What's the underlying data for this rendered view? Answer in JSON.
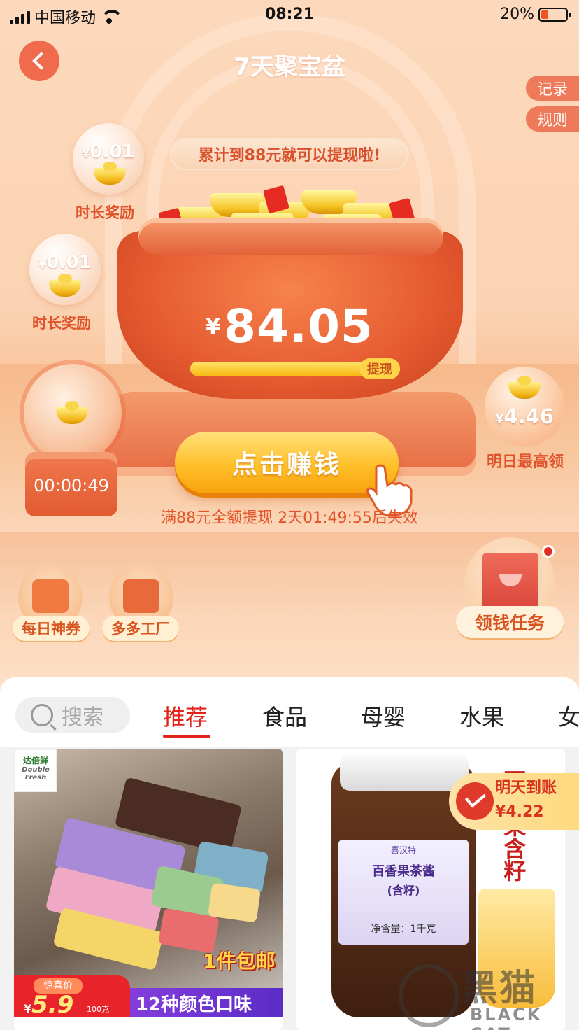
{
  "status_bar": {
    "carrier": "中国移动",
    "time": "08:21",
    "battery": "20%"
  },
  "header": {
    "title": "7天聚宝盆",
    "record": "记录",
    "rules": "规则"
  },
  "banner": "累计到88元就可以提现啦!",
  "bubbles": [
    {
      "amount": "0.01",
      "label": "时长奖励"
    },
    {
      "amount": "0.01",
      "label": "时长奖励"
    }
  ],
  "currency": "¥",
  "pot": {
    "amount": "84.05",
    "progress": 0.955,
    "withdraw": "提现"
  },
  "timer": "00:00:49",
  "tomorrow": {
    "amount": "4.46",
    "label": "明日最高领"
  },
  "earn_button": "点击赚钱",
  "notice": "满88元全额提现 2天01:49:55后失效",
  "quick_links": [
    {
      "label": "每日神券",
      "icon": "coupon-icon"
    },
    {
      "label": "多多工厂",
      "icon": "factory-icon"
    }
  ],
  "task": {
    "label": "领钱任务",
    "icon": "task-book-icon"
  },
  "feed": {
    "search_placeholder": "搜索",
    "tabs": [
      "推荐",
      "食品",
      "母婴",
      "水果",
      "女"
    ],
    "active_tab": 0,
    "products": [
      {
        "brand": "达倍鲜",
        "brand_en": "Double Fresh",
        "price_label": "惊喜价",
        "price": "5.9",
        "unit": "100克",
        "promo": "12种颜色口味",
        "shipping": "1件包邮"
      },
      {
        "label_brand": "喜汉特",
        "label_name": "百香果茶酱",
        "label_sub": "(含籽)",
        "label_weight": "净含量：1千克",
        "side_text": "百香果含籽"
      }
    ],
    "arrive_tag": {
      "title": "明天到账",
      "amount": "¥4.22"
    }
  },
  "watermark": {
    "cn": "黑猫",
    "en": "BLACK CAT"
  },
  "colors": {
    "accent": "#e2231a",
    "orange": "#f06b4c",
    "gold": "#ffc02a"
  }
}
